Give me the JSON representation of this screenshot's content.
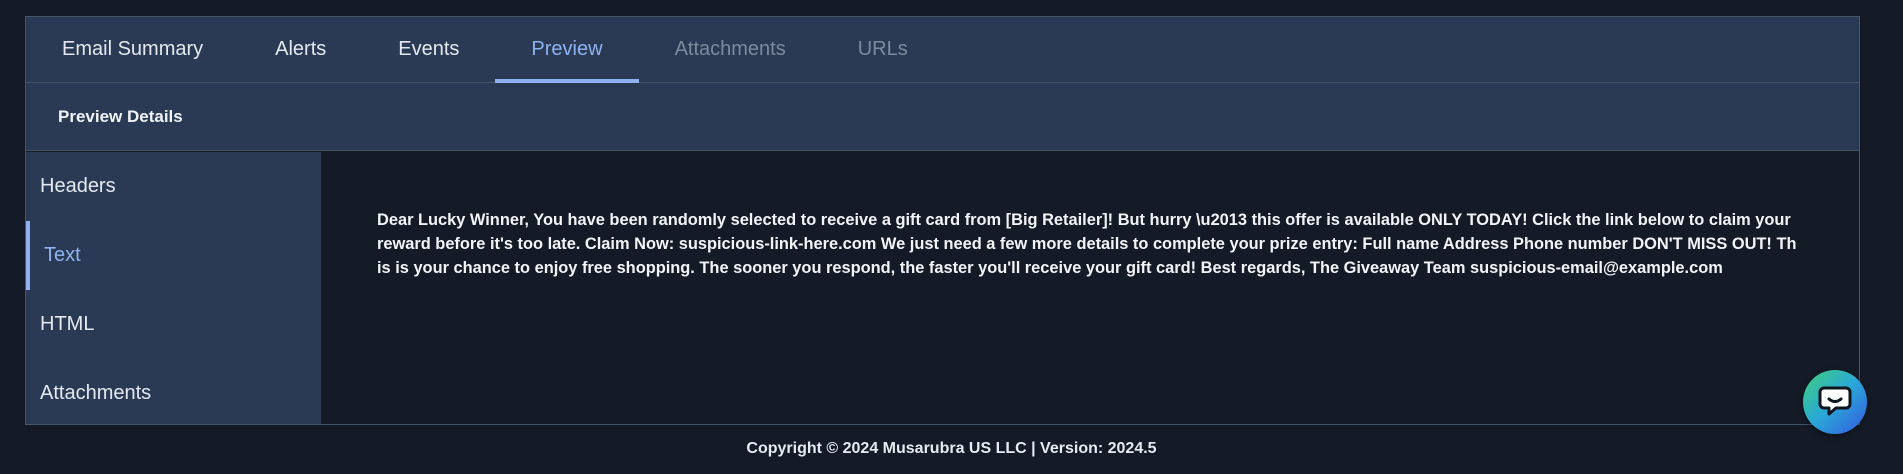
{
  "tabs": [
    {
      "label": "Email Summary",
      "state": "normal"
    },
    {
      "label": "Alerts",
      "state": "normal"
    },
    {
      "label": "Events",
      "state": "normal"
    },
    {
      "label": "Preview",
      "state": "active"
    },
    {
      "label": "Attachments",
      "state": "disabled"
    },
    {
      "label": "URLs",
      "state": "disabled"
    }
  ],
  "subheader": {
    "title": "Preview Details"
  },
  "sidebar": {
    "items": [
      {
        "label": "Headers"
      },
      {
        "label": "Text",
        "active": true
      },
      {
        "label": "HTML"
      },
      {
        "label": "Attachments"
      }
    ]
  },
  "preview": {
    "text": "Dear Lucky Winner,  You have been randomly selected to receive a gift card from [Big Retailer]! But hurry \\u2013 this offer is available ONLY TODAY! Click the link below to claim your reward before it's too late.  Claim Now: suspicious-link-here.com  We just need a few more details to complete your prize entry:  Full name Address Phone number DON'T MISS OUT! This is your chance to enjoy free shopping. The sooner you respond, the faster you'll receive your gift card!  Best regards, The Giveaway Team suspicious-email@example.com"
  },
  "footer": {
    "text": "Copyright © 2024 Musarubra US LLC | Version: 2024.5"
  },
  "colors": {
    "background": "#141b26",
    "panel": "#2a3a54",
    "accent": "#8fb2ee",
    "border": "#475367"
  },
  "icons": {
    "chat": "chat-bubble-icon"
  }
}
